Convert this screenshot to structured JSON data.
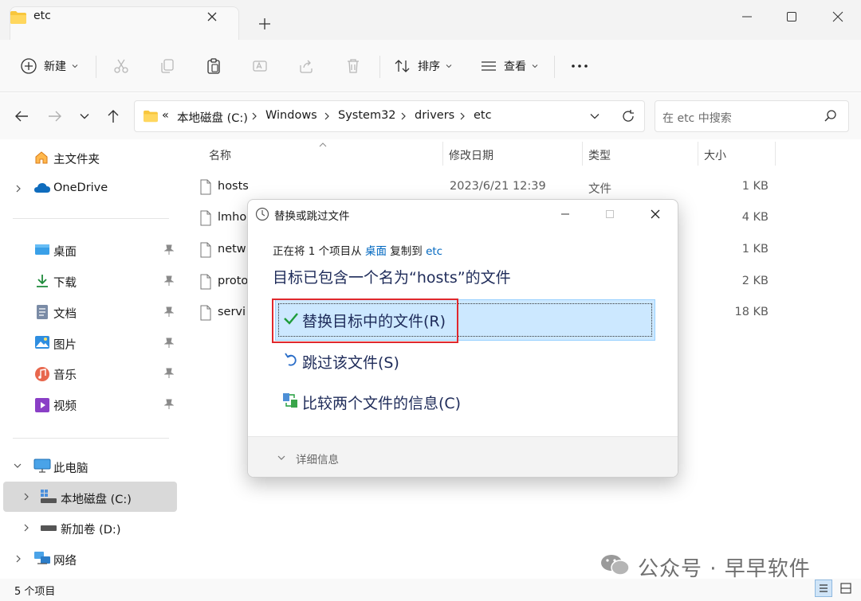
{
  "window": {
    "tab_title": "etc",
    "new_tab": "+"
  },
  "toolbar": {
    "new_label": "新建",
    "sort_label": "排序",
    "view_label": "查看",
    "more_label": "···"
  },
  "address": {
    "overflow": "«",
    "crumbs": [
      "本地磁盘 (C:)",
      "Windows",
      "System32",
      "drivers",
      "etc"
    ],
    "search_placeholder": "在 etc 中搜索"
  },
  "sidebar": {
    "home": "主文件夹",
    "onedrive": "OneDrive",
    "quick": [
      "桌面",
      "下载",
      "文档",
      "图片",
      "音乐",
      "视频"
    ],
    "this_pc": "此电脑",
    "drive_c": "本地磁盘 (C:)",
    "drive_d": "新加卷 (D:)",
    "network": "网络"
  },
  "columns": {
    "name": "名称",
    "date": "修改日期",
    "type": "类型",
    "size": "大小"
  },
  "files": [
    {
      "name": "hosts",
      "date": "2023/6/21 12:39",
      "type": "文件",
      "size": "1 KB"
    },
    {
      "name": "lmho",
      "date": "",
      "type": "",
      "size": "4 KB"
    },
    {
      "name": "netw",
      "date": "",
      "type": "",
      "size": "1 KB"
    },
    {
      "name": "proto",
      "date": "",
      "type": "",
      "size": "2 KB"
    },
    {
      "name": "servi",
      "date": "",
      "type": "",
      "size": "18 KB"
    }
  ],
  "dialog": {
    "title": "替换或跳过文件",
    "line_prefix": "正在将 1 个项目从",
    "source": "桌面",
    "line_mid": "复制到",
    "dest": "etc",
    "heading": "目标已包含一个名为“hosts”的文件",
    "option_replace": "替换目标中的文件(R)",
    "option_skip": "跳过该文件(S)",
    "option_compare": "比较两个文件的信息(C)",
    "details": "详细信息"
  },
  "status": {
    "count": "5 个项目"
  },
  "watermark": "公众号 · 早早软件",
  "colors": {
    "accent": "#0067c0",
    "selection": "#cce8ff",
    "highlight_box": "#e0282d"
  }
}
